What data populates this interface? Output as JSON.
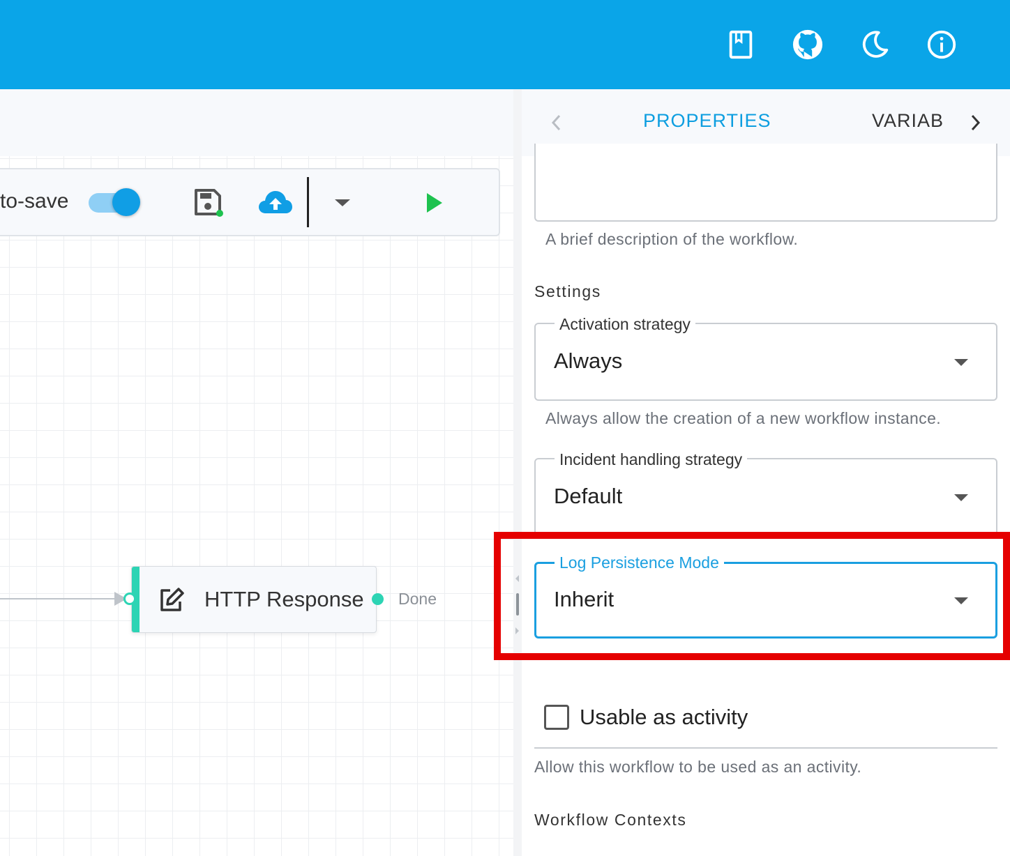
{
  "appbar": {
    "icons": [
      "book-icon",
      "github-icon",
      "moon-icon",
      "info-icon"
    ],
    "color": "#0aa5e8"
  },
  "toolbar": {
    "autosave_label": "to-save",
    "autosave_enabled": true,
    "icons": [
      "save-icon",
      "cloud-upload-icon",
      "chevron-down-icon",
      "play-icon"
    ]
  },
  "canvas": {
    "node": {
      "title": "HTTP Response",
      "icon": "edit-icon",
      "outcome_label": "Done",
      "accent": "#2dd4b4"
    }
  },
  "panel": {
    "tabs": {
      "active": "PROPERTIES",
      "next": "VARIAB"
    },
    "description_helper": "A brief description of the workflow.",
    "settings_title": "Settings",
    "activation": {
      "label": "Activation strategy",
      "value": "Always",
      "helper": "Always allow the creation of a new workflow instance."
    },
    "incident": {
      "label": "Incident handling strategy",
      "value": "Default"
    },
    "log_persistence": {
      "label": "Log Persistence Mode",
      "value": "Inherit"
    },
    "usable_as_activity": {
      "label": "Usable as activity",
      "checked": false,
      "helper": "Allow this workflow to be used as an activity."
    },
    "contexts_title": "Workflow Contexts",
    "accent": "#0d9ee0",
    "highlight_color": "#e50000"
  }
}
